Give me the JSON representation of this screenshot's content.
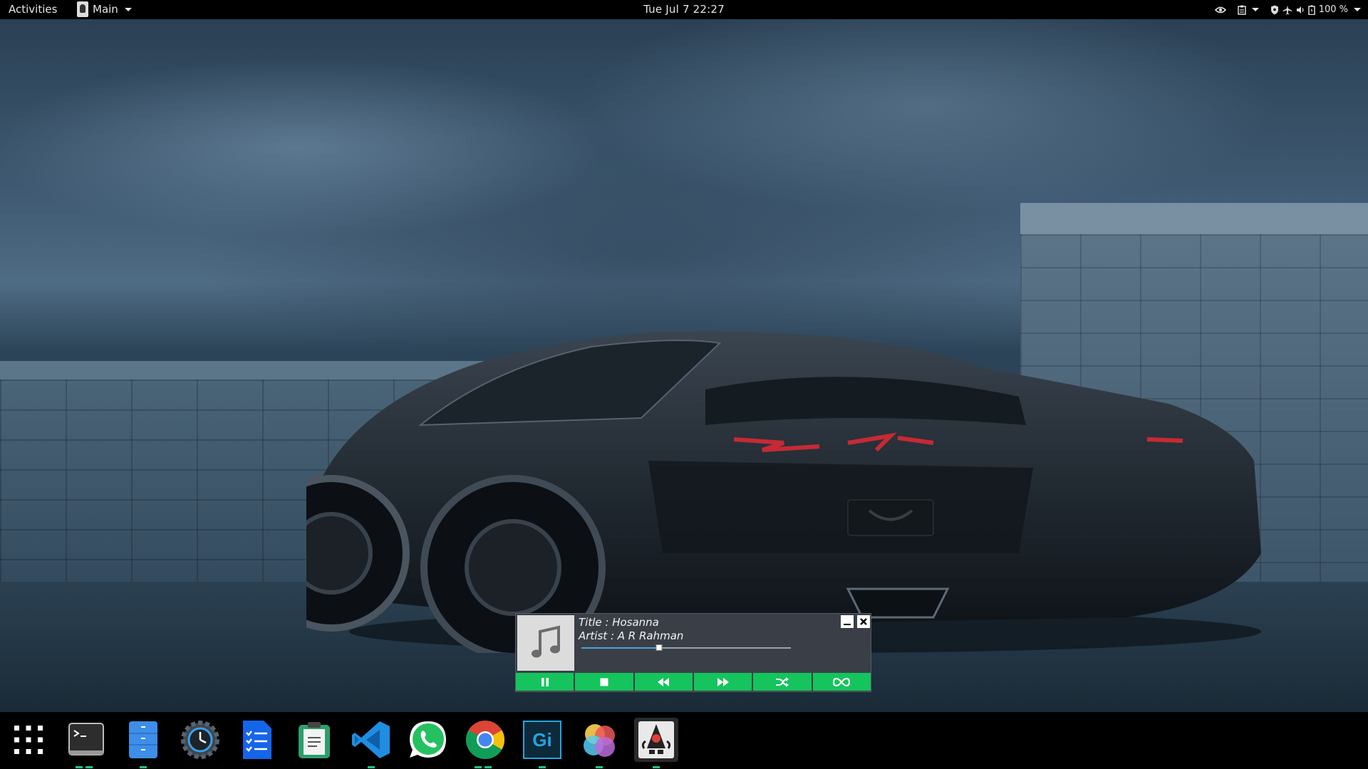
{
  "topbar": {
    "activities": "Activities",
    "app_menu": "Main",
    "clock": "Tue Jul 7  22:27",
    "battery": "100 %"
  },
  "player": {
    "title": "Title : Hosanna",
    "artist": "Artist : A R Rahman",
    "progress": 0.37,
    "controls": [
      "pause",
      "stop",
      "rewind",
      "fast-forward",
      "shuffle",
      "repeat"
    ],
    "accent": "#15c45c"
  },
  "dock": {
    "items": [
      {
        "name": "show-applications",
        "icon": "app-grid-icon",
        "running": 0
      },
      {
        "name": "terminal",
        "icon": "terminal-icon",
        "running": 2
      },
      {
        "name": "files",
        "icon": "files-icon",
        "running": 1
      },
      {
        "name": "system-monitor",
        "icon": "gear-clock-icon",
        "running": 0
      },
      {
        "name": "tasks",
        "icon": "checklist-icon",
        "running": 0
      },
      {
        "name": "notes",
        "icon": "clipboard-icon",
        "running": 0
      },
      {
        "name": "vscode",
        "icon": "vscode-icon",
        "running": 1
      },
      {
        "name": "whatsapp",
        "icon": "whatsapp-icon",
        "running": 0
      },
      {
        "name": "chrome",
        "icon": "chrome-icon",
        "running": 2
      },
      {
        "name": "gimp-studio",
        "icon": "gi-icon",
        "running": 1
      },
      {
        "name": "color-app",
        "icon": "color-circles-icon",
        "running": 1
      },
      {
        "name": "java-app",
        "icon": "java-duke-icon",
        "running": 1,
        "active": true
      }
    ]
  }
}
